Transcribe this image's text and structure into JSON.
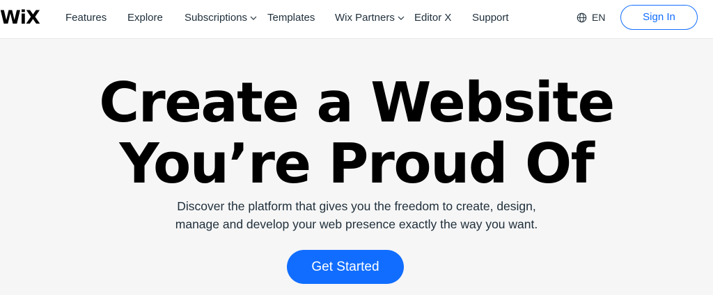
{
  "header": {
    "logo": "WiX",
    "nav": {
      "features": "Features",
      "explore": "Explore",
      "subscriptions": "Subscriptions",
      "templates": "Templates",
      "wix_partners": "Wix Partners",
      "editor_x": "Editor X",
      "support": "Support"
    },
    "language": "EN",
    "sign_in": "Sign In"
  },
  "hero": {
    "title_line1": "Create a Website",
    "title_line2": "You’re Proud Of",
    "subtitle_line1": "Discover the platform that gives you the freedom to create, design,",
    "subtitle_line2": "manage and develop your web presence exactly the way you want.",
    "cta": "Get Started"
  },
  "colors": {
    "accent": "#116dff",
    "background": "#f6f6f6",
    "header_bg": "#ffffff",
    "text": "#20303c"
  },
  "icons": {
    "language": "globe-icon",
    "dropdown": "chevron-down-icon"
  }
}
